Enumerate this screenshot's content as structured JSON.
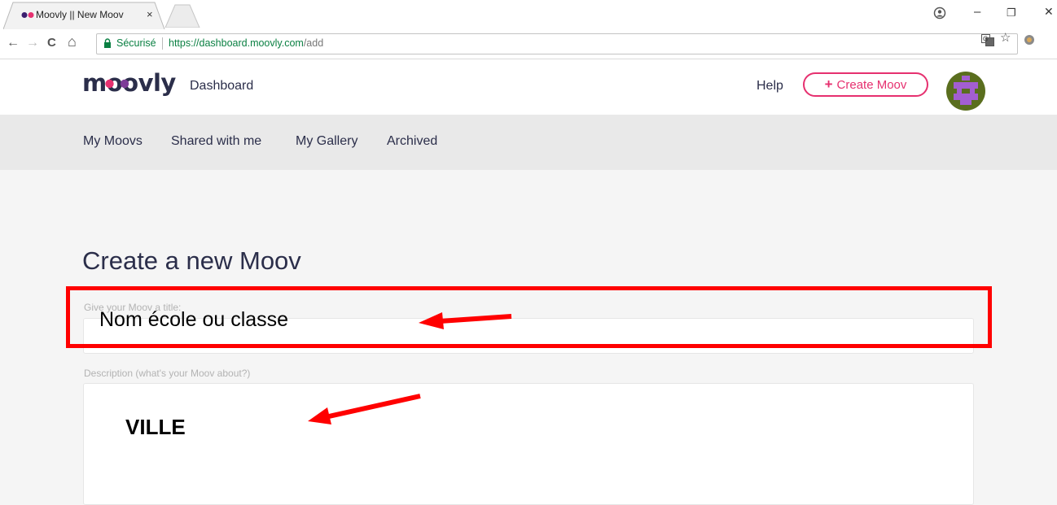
{
  "browser": {
    "tab_title": "Moovly || New Moov",
    "tab_close": "×",
    "secure_label": "Sécurisé",
    "url_base": "https://dashboard.moovly.com",
    "url_path": "/add",
    "back_glyph": "←",
    "forward_glyph": "→",
    "reload_glyph": "C",
    "home_glyph": "⌂",
    "star_glyph": "☆",
    "minimize_glyph": "–",
    "restore_glyph": "❐",
    "close_glyph": "✕"
  },
  "header": {
    "logo_text": "moovly",
    "dashboard_label": "Dashboard",
    "help_label": "Help",
    "create_plus": "+",
    "create_label": "Create Moov"
  },
  "subnav": {
    "items": [
      "My Moovs",
      "Shared with me",
      "My Gallery",
      "Archived"
    ]
  },
  "main": {
    "title": "Create a new Moov",
    "title_field_label": "Give your Moov a title:",
    "title_field_value": "Nom école ou classe",
    "desc_field_label": "Description (what's your Moov about?)",
    "desc_field_value": "VILLE"
  },
  "colors": {
    "accent": "#e6306f",
    "text_dark": "#2b2e4a",
    "annotation_red": "#ff0000",
    "secure_green": "#0b8043"
  },
  "icons": [
    "lock-icon",
    "translate-icon",
    "star-icon",
    "extension-icon",
    "avatar-icon",
    "arrow-annotation"
  ]
}
